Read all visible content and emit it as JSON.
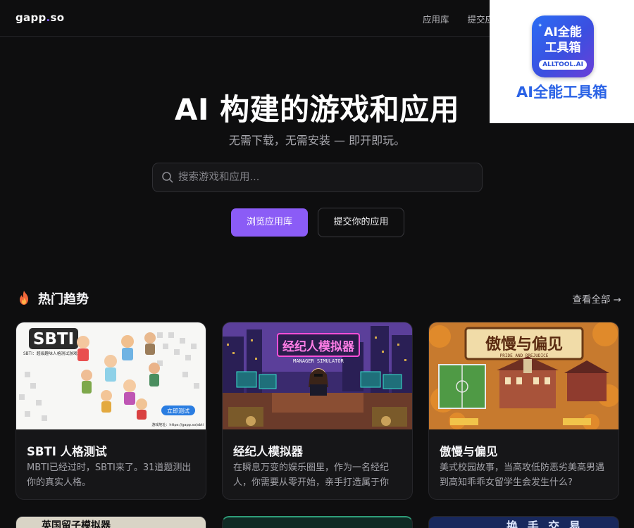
{
  "nav": {
    "logo_main": "gapp",
    "logo_dot": ".",
    "logo_tld": "so",
    "links": [
      "应用库",
      "提交应用"
    ]
  },
  "watermark": {
    "badge_line1": "AI全能",
    "badge_line2": "工具箱",
    "badge_domain": "ALLTOOL.AI",
    "caption": "AI全能工具箱"
  },
  "hero": {
    "title": "AI 构建的游戏和应用",
    "subtitle": "无需下载，无需安装 — 即开即玩。",
    "search_placeholder": "搜索游戏和应用...",
    "primary_button": "浏览应用库",
    "secondary_button": "提交你的应用"
  },
  "trending": {
    "title": "热门趋势",
    "view_all": "查看全部 →",
    "cards": [
      {
        "title": "SBTI 人格测试",
        "desc": "MBTI已经过时，SBTI来了。31道题测出你的真实人格。",
        "thumb_text": "SBTI",
        "thumb_sub": "SBTI：超级趣味人格测试游戏",
        "thumb_btn": "立即测试",
        "thumb_url": "游戏地址：https://gapp.so/sbti"
      },
      {
        "title": "经纪人模拟器",
        "desc": "在瞬息万变的娱乐圈里，作为一名经纪人，你需要从零开始，亲手打造属于你的...",
        "thumb_text": "经纪人模拟器",
        "thumb_sub": "MANAGER SIMULATOR"
      },
      {
        "title": "傲慢与偏见",
        "desc": "美式校园故事，当高攻低防恶劣美高男遇到高知乖乖女留学生会发生什么?",
        "thumb_text": "傲慢与偏见",
        "thumb_sub": "PRIDE AND PREJUDICE"
      }
    ],
    "next_row": [
      {
        "thumb_text": "英国留子模拟器"
      },
      {
        "thumb_text": ""
      },
      {
        "thumb_text": "换 手 交 易"
      }
    ]
  },
  "colors": {
    "background": "#0e0e0f",
    "accent": "#8b5cf6",
    "brand_dot": "#7c5cf5",
    "watermark_blue": "#2b63e6"
  }
}
